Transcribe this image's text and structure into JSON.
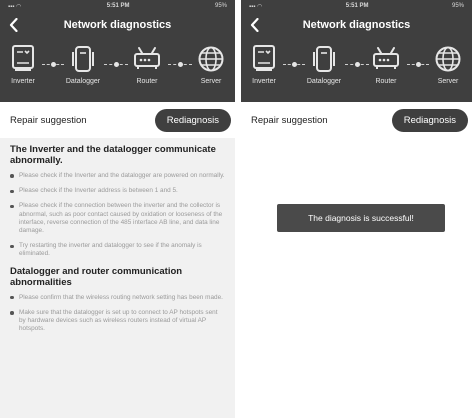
{
  "left": {
    "status": {
      "time": "5:51 PM",
      "battery": "95%"
    },
    "header": {
      "title": "Network diagnostics"
    },
    "flow": {
      "nodes": [
        "Inverter",
        "Datalogger",
        "Router",
        "Server"
      ]
    },
    "repair": {
      "label": "Repair suggestion",
      "button": "Rediagnosis"
    },
    "sections": [
      {
        "title": "The Inverter and the datalogger communicate abnormally.",
        "items": [
          "Please check if the Inverter and the datalogger are powered on normally.",
          "Please check if the Inverter address is between 1 and 5.",
          "Please check if the connection between the inverter and the collector is abnormal, such as poor contact caused by oxidation or looseness of the interface, reverse connection of the 485 interface AB line, and data line damage.",
          "Try restarting the inverter and datalogger to see if the anomaly is eliminated."
        ]
      },
      {
        "title": "Datalogger and router communication abnormalities",
        "items": [
          "Please confirm that the wireless routing network setting has been made.",
          "Make sure that the datalogger is set up to connect to AP hotspots sent by hardware devices such as wireless routers instead of virtual AP hotspots."
        ]
      }
    ]
  },
  "right": {
    "status": {
      "time": "5:51 PM",
      "battery": "95%"
    },
    "header": {
      "title": "Network diagnostics"
    },
    "flow": {
      "nodes": [
        "Inverter",
        "Datalogger",
        "Router",
        "Server"
      ]
    },
    "repair": {
      "label": "Repair suggestion",
      "button": "Rediagnosis"
    },
    "toast": "The diagnosis is successful!"
  },
  "icons": {
    "back": "chevron-left-icon",
    "inverter": "inverter-icon",
    "datalogger": "datalogger-icon",
    "router": "router-icon",
    "server": "globe-icon"
  },
  "colors": {
    "header_bg": "#3f3f3f",
    "button_bg": "#3f3f3f",
    "content_bg": "#f1f1f1",
    "toast_bg": "#4a4a4a"
  }
}
